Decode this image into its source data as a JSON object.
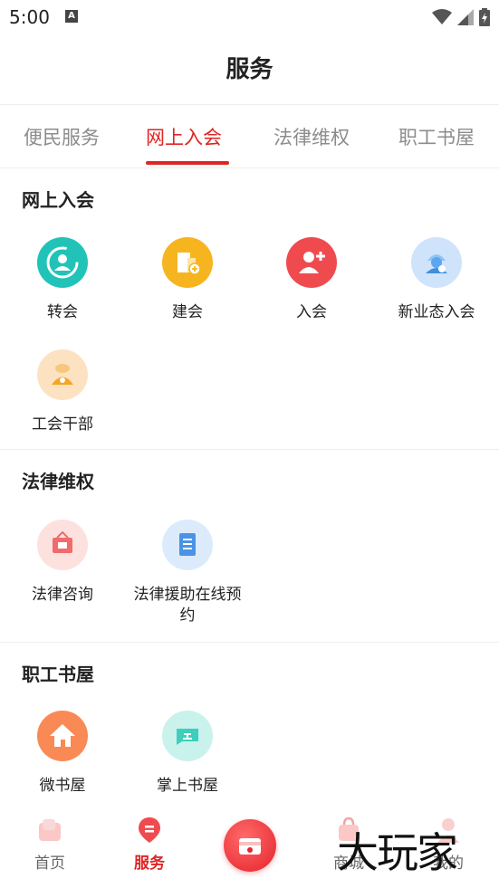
{
  "status_bar": {
    "time": "5:00",
    "notification_badge": "A"
  },
  "header": {
    "title": "服务"
  },
  "tabs": [
    {
      "label": "便民服务"
    },
    {
      "label": "网上入会"
    },
    {
      "label": "法律维权"
    },
    {
      "label": "职工书屋"
    }
  ],
  "sections": {
    "membership": {
      "title": "网上入会",
      "items": [
        {
          "label": "转会",
          "icon": "transfer-icon",
          "color": "#21c3b8"
        },
        {
          "label": "建会",
          "icon": "building-icon",
          "color": "#f6b51f"
        },
        {
          "label": "入会",
          "icon": "add-member-icon",
          "color": "#ef4b4f"
        },
        {
          "label": "新业态入会",
          "icon": "courier-icon",
          "color": "#8fc4f5"
        },
        {
          "label": "工会干部",
          "icon": "cadre-icon",
          "color": "#f7b860"
        }
      ]
    },
    "legal": {
      "title": "法律维权",
      "items": [
        {
          "label": "法律咨询",
          "icon": "consult-icon",
          "color": "#f48a86"
        },
        {
          "label": "法律援助在线预约",
          "icon": "appointment-icon",
          "color": "#9cc8f5"
        }
      ]
    },
    "library": {
      "title": "职工书屋",
      "items": [
        {
          "label": "微书屋",
          "icon": "house-icon",
          "color": "#fa8a55"
        },
        {
          "label": "掌上书屋",
          "icon": "book-icon",
          "color": "#4fd6c4"
        }
      ]
    }
  },
  "bottom_nav": [
    {
      "label": "首页",
      "icon": "home-icon"
    },
    {
      "label": "服务",
      "icon": "service-icon",
      "active": true
    },
    {
      "label": "",
      "icon": "wallet-icon"
    },
    {
      "label": "商城",
      "icon": "shop-icon"
    },
    {
      "label": "我的",
      "icon": "profile-icon"
    }
  ],
  "watermark": "大玩家",
  "colors": {
    "accent": "#e02424",
    "divider": "#eeeeee",
    "muted_text": "#8c8c8c"
  }
}
